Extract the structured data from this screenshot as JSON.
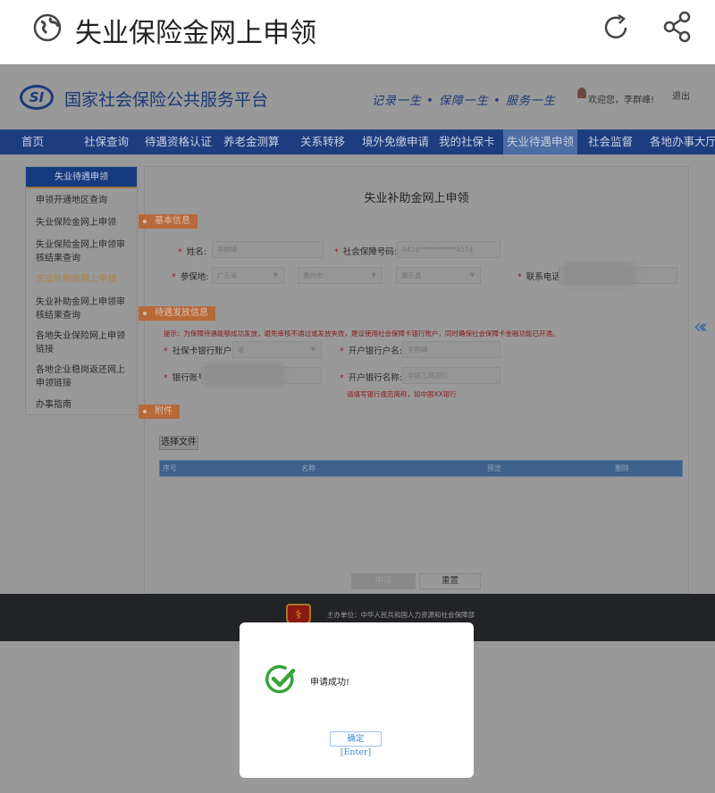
{
  "app_bar": {
    "title": "失业保险金网上申领",
    "icons": [
      "globe-icon",
      "refresh-icon",
      "share-icon"
    ]
  },
  "header": {
    "logo_text": "SI",
    "site_name": "国家社会保险公共服务平台",
    "slogan": "记录一生 • 保障一生 • 服务一生",
    "welcome": "欢迎您，李群峰!",
    "logout": "退出"
  },
  "nav": [
    "首页",
    "社保查询",
    "待遇资格认证",
    "养老金测算",
    "关系转移",
    "境外免缴申请",
    "我的社保卡",
    "失业待遇申领",
    "社会监督",
    "各地办事大厅"
  ],
  "nav_active": "失业待遇申领",
  "sidebar": {
    "title": "失业待遇申领",
    "items": [
      "申领开通地区查询",
      "失业保险金网上申领",
      "失业保险金网上申领审核结果查询",
      "失业补助金网上申领",
      "失业补助金网上申领审核结果查询",
      "各地失业保险网上申领链接",
      "各地企业稳岗返还网上申领链接",
      "办事指南"
    ],
    "active": "失业补助金网上申领"
  },
  "form": {
    "title": "失业补助金网上申领",
    "sections": {
      "basic": "基本信息",
      "payment": "待遇发放信息",
      "attachment": "附件"
    },
    "name_label": "姓名:",
    "name_value": "李群峰",
    "ssn_label": "社会保障号码:",
    "ssn_value": "4416***********4574",
    "place_label": "参保地:",
    "province": "广东省",
    "city": "惠州市",
    "county": "惠东县",
    "phone_label": "联系电话:",
    "hint": "提示：为保障待遇能够成功发放，避免审核不通过或发放失败，建议使用社会保障卡银行账户，同时确保社会保障卡金融功能已开通。",
    "card_account_label": "社保卡银行账户:",
    "card_account_value": "是",
    "account_name_label": "开户银行户名:",
    "account_name_value": "李群峰",
    "account_no_label": "银行账号",
    "bank_name_label": "开户银行名称:",
    "bank_name_value": "中国工商银行",
    "bank_note": "请填写银行规范简称，如中国XX银行",
    "choose_file": "选择文件",
    "table_headers": [
      "序号",
      "名称",
      "预览",
      "删除"
    ],
    "submit": "申请",
    "reset": "重置"
  },
  "footer": {
    "host": "主办单位：中华人民共和国人力资源和社会保障部"
  },
  "dialog": {
    "message": "申请成功!",
    "ok": "确定 [Enter]",
    "icon": "check-circle-icon",
    "accent": "#3aa33a"
  }
}
